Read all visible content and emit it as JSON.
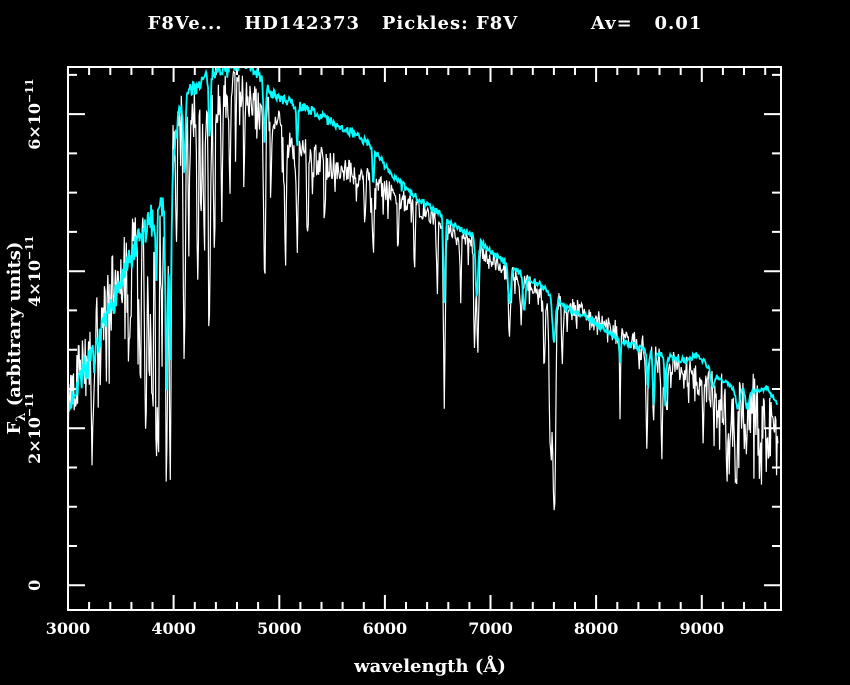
{
  "title": "F8Ve...   HD142373   Pickles: F8V          Av=   0.01",
  "axis": {
    "x_label": "wavelength (Å)",
    "y_label_pre": "F",
    "y_label_sub": "λ",
    "y_label_post": " (arbitrary units)"
  },
  "chart_data": {
    "type": "line",
    "title": "F8Ve... HD142373 Pickles: F8V Av= 0.01",
    "target_name": "HD142373",
    "spectral_type_label": "F8Ve...",
    "template_label": "Pickles: F8V",
    "Av": "0.01",
    "xlabel": "wavelength (Å)",
    "ylabel": "Fλ (arbitrary units)",
    "flux_scale": "1e-11",
    "xlim": [
      3000,
      9750
    ],
    "ylim": [
      -0.315,
      6.6
    ],
    "xticks_major": [
      3000,
      4000,
      5000,
      6000,
      7000,
      8000,
      9000
    ],
    "xtick_minor_step": 200,
    "yticks_major": [
      0,
      2,
      4,
      6
    ],
    "ytick_labels": [
      "0",
      "2×10^−11",
      "4×10^−11",
      "6×10^−11"
    ],
    "ytick_minor_step": 0.5,
    "background": "#000000",
    "axis_color": "#ffffff",
    "grid": false,
    "legend": "none",
    "series": [
      {
        "name": "HD142373 observed spectrum",
        "color": "#ffffff",
        "stroke_width": 1.2,
        "x_range": [
          3000,
          9725
        ],
        "continuum": [
          [
            3000,
            2.35
          ],
          [
            3060,
            2.6
          ],
          [
            3150,
            2.95
          ],
          [
            3250,
            3.1
          ],
          [
            3350,
            3.45
          ],
          [
            3450,
            3.85
          ],
          [
            3550,
            4.1
          ],
          [
            3650,
            4.35
          ],
          [
            3750,
            4.6
          ],
          [
            3850,
            4.8
          ],
          [
            3920,
            4.9
          ],
          [
            3990,
            5.5
          ],
          [
            4050,
            5.95
          ],
          [
            4120,
            6.1
          ],
          [
            4220,
            6.05
          ],
          [
            4320,
            6.1
          ],
          [
            4420,
            6.2
          ],
          [
            4520,
            6.25
          ],
          [
            4620,
            6.25
          ],
          [
            4720,
            6.2
          ],
          [
            4800,
            6.1
          ],
          [
            4900,
            6.0
          ],
          [
            5000,
            5.85
          ],
          [
            5100,
            5.6
          ],
          [
            5300,
            5.45
          ],
          [
            5500,
            5.35
          ],
          [
            5700,
            5.25
          ],
          [
            5900,
            5.12
          ],
          [
            6050,
            5.0
          ],
          [
            6240,
            4.85
          ],
          [
            6400,
            4.72
          ],
          [
            6550,
            4.58
          ],
          [
            6700,
            4.45
          ],
          [
            6850,
            4.33
          ],
          [
            7000,
            4.15
          ],
          [
            7150,
            4.0
          ],
          [
            7320,
            3.88
          ],
          [
            7500,
            3.72
          ],
          [
            7700,
            3.58
          ],
          [
            7900,
            3.48
          ],
          [
            8100,
            3.32
          ],
          [
            8300,
            3.15
          ],
          [
            8500,
            3.0
          ],
          [
            8700,
            2.85
          ],
          [
            8900,
            2.7
          ],
          [
            9000,
            2.6
          ],
          [
            9100,
            2.5
          ],
          [
            9200,
            2.4
          ],
          [
            9300,
            2.3
          ],
          [
            9400,
            2.25
          ],
          [
            9500,
            2.3
          ],
          [
            9600,
            2.2
          ],
          [
            9725,
            2.0
          ]
        ],
        "noise_amplitude": [
          [
            3000,
            0.25
          ],
          [
            3100,
            0.45
          ],
          [
            3300,
            0.5
          ],
          [
            3500,
            0.45
          ],
          [
            3700,
            0.5
          ],
          [
            3900,
            0.55
          ],
          [
            4000,
            0.4
          ],
          [
            4200,
            0.38
          ],
          [
            4400,
            0.33
          ],
          [
            4700,
            0.28
          ],
          [
            5000,
            0.24
          ],
          [
            5300,
            0.2
          ],
          [
            5600,
            0.17
          ],
          [
            6000,
            0.14
          ],
          [
            6500,
            0.12
          ],
          [
            7000,
            0.11
          ],
          [
            7500,
            0.11
          ],
          [
            8000,
            0.12
          ],
          [
            8400,
            0.14
          ],
          [
            8800,
            0.16
          ],
          [
            9100,
            0.28
          ],
          [
            9250,
            0.42
          ],
          [
            9400,
            0.45
          ],
          [
            9550,
            0.38
          ],
          [
            9725,
            0.28
          ]
        ],
        "absorption_lines": [
          [
            3230,
            12,
            1.2
          ],
          [
            3580,
            12,
            1.5
          ],
          [
            3680,
            10,
            1.7
          ],
          [
            3735,
            10,
            2.4
          ],
          [
            3770,
            9,
            1.6
          ],
          [
            3798,
            9,
            2.0
          ],
          [
            3835,
            10,
            2.5
          ],
          [
            3855,
            8,
            2.6
          ],
          [
            3890,
            8,
            2.1
          ],
          [
            3933,
            9,
            4.0
          ],
          [
            3968,
            9,
            3.9
          ],
          [
            4025,
            7,
            1.5
          ],
          [
            4101,
            9,
            3.4
          ],
          [
            4144,
            7,
            1.6
          ],
          [
            4226,
            7,
            2.3
          ],
          [
            4260,
            6,
            1.4
          ],
          [
            4290,
            7,
            1.7
          ],
          [
            4340,
            9,
            2.5
          ],
          [
            4383,
            7,
            1.9
          ],
          [
            4455,
            6,
            1.3
          ],
          [
            4530,
            6,
            1.2
          ],
          [
            4668,
            6,
            1.1
          ],
          [
            4861,
            9,
            2.3
          ],
          [
            4920,
            6,
            1.0
          ],
          [
            5060,
            7,
            1.5
          ],
          [
            5170,
            8,
            1.4
          ],
          [
            5270,
            7,
            1.1
          ],
          [
            5430,
            6,
            0.8
          ],
          [
            5811,
            6,
            0.6
          ],
          [
            5890,
            8,
            1.0
          ],
          [
            6123,
            6,
            0.6
          ],
          [
            6280,
            7,
            0.7
          ],
          [
            6495,
            7,
            0.8
          ],
          [
            6563,
            9,
            2.1
          ],
          [
            6717,
            6,
            0.7
          ],
          [
            6850,
            8,
            1.3
          ],
          [
            6880,
            8,
            1.4
          ],
          [
            7180,
            10,
            0.8
          ],
          [
            7290,
            8,
            0.6
          ],
          [
            7510,
            8,
            0.9
          ],
          [
            7570,
            14,
            2.0
          ],
          [
            7605,
            12,
            2.6
          ],
          [
            7680,
            7,
            0.7
          ],
          [
            8227,
            7,
            0.7
          ],
          [
            8480,
            8,
            1.2
          ],
          [
            8545,
            8,
            0.9
          ],
          [
            8620,
            8,
            1.1
          ],
          [
            8670,
            7,
            0.8
          ],
          [
            9015,
            8,
            0.6
          ],
          [
            9250,
            15,
            0.8
          ],
          [
            9320,
            12,
            1.1
          ],
          [
            9420,
            12,
            0.7
          ],
          [
            9545,
            10,
            0.6
          ]
        ]
      },
      {
        "name": "Pickles F8V template",
        "color": "#00ffff",
        "stroke_width": 1.8,
        "x_range": [
          3000,
          9720
        ],
        "continuum": [
          [
            3000,
            2.15
          ],
          [
            3060,
            2.5
          ],
          [
            3150,
            2.75
          ],
          [
            3250,
            2.9
          ],
          [
            3350,
            3.3
          ],
          [
            3450,
            3.7
          ],
          [
            3550,
            4.0
          ],
          [
            3650,
            4.3
          ],
          [
            3750,
            4.55
          ],
          [
            3850,
            4.8
          ],
          [
            3920,
            4.9
          ],
          [
            3990,
            5.4
          ],
          [
            4050,
            6.0
          ],
          [
            4120,
            6.25
          ],
          [
            4220,
            6.35
          ],
          [
            4320,
            6.5
          ],
          [
            4420,
            6.55
          ],
          [
            4520,
            6.6
          ],
          [
            4620,
            6.62
          ],
          [
            4720,
            6.6
          ],
          [
            4800,
            6.5
          ],
          [
            4900,
            6.3
          ],
          [
            5000,
            6.2
          ],
          [
            5100,
            6.15
          ],
          [
            5300,
            6.05
          ],
          [
            5500,
            5.9
          ],
          [
            5700,
            5.75
          ],
          [
            5870,
            5.6
          ],
          [
            6050,
            5.25
          ],
          [
            6240,
            5.0
          ],
          [
            6400,
            4.85
          ],
          [
            6550,
            4.7
          ],
          [
            6700,
            4.55
          ],
          [
            6850,
            4.45
          ],
          [
            7000,
            4.25
          ],
          [
            7150,
            4.1
          ],
          [
            7320,
            3.95
          ],
          [
            7500,
            3.8
          ],
          [
            7700,
            3.55
          ],
          [
            7900,
            3.42
          ],
          [
            8100,
            3.25
          ],
          [
            8300,
            3.08
          ],
          [
            8500,
            2.98
          ],
          [
            8700,
            2.9
          ],
          [
            8850,
            2.86
          ],
          [
            8960,
            2.95
          ],
          [
            9050,
            2.8
          ],
          [
            9150,
            2.65
          ],
          [
            9250,
            2.55
          ],
          [
            9350,
            2.5
          ],
          [
            9450,
            2.45
          ],
          [
            9550,
            2.48
          ],
          [
            9620,
            2.52
          ],
          [
            9720,
            2.28
          ]
        ],
        "noise_amplitude": [
          [
            3000,
            0.18
          ],
          [
            3200,
            0.2
          ],
          [
            3500,
            0.18
          ],
          [
            3800,
            0.22
          ],
          [
            4000,
            0.12
          ],
          [
            4300,
            0.08
          ],
          [
            4700,
            0.07
          ],
          [
            5200,
            0.06
          ],
          [
            6000,
            0.05
          ],
          [
            7000,
            0.04
          ],
          [
            8000,
            0.04
          ],
          [
            9000,
            0.04
          ],
          [
            9720,
            0.03
          ]
        ],
        "absorption_lines": [
          [
            3835,
            8,
            0.8
          ],
          [
            3933,
            10,
            2.5
          ],
          [
            3968,
            10,
            2.1
          ],
          [
            4101,
            9,
            0.9
          ],
          [
            4340,
            9,
            0.8
          ],
          [
            4861,
            9,
            0.7
          ],
          [
            5170,
            8,
            0.5
          ],
          [
            5890,
            7,
            0.45
          ],
          [
            6563,
            9,
            1.1
          ],
          [
            6870,
            12,
            0.75
          ],
          [
            7180,
            12,
            0.5
          ],
          [
            7320,
            12,
            0.45
          ],
          [
            7600,
            15,
            0.55
          ],
          [
            8227,
            7,
            0.3
          ],
          [
            8490,
            8,
            0.5
          ],
          [
            8545,
            8,
            0.7
          ],
          [
            8655,
            8,
            0.6
          ],
          [
            9100,
            15,
            0.2
          ],
          [
            9340,
            18,
            0.25
          ],
          [
            9430,
            15,
            0.2
          ]
        ]
      }
    ]
  }
}
